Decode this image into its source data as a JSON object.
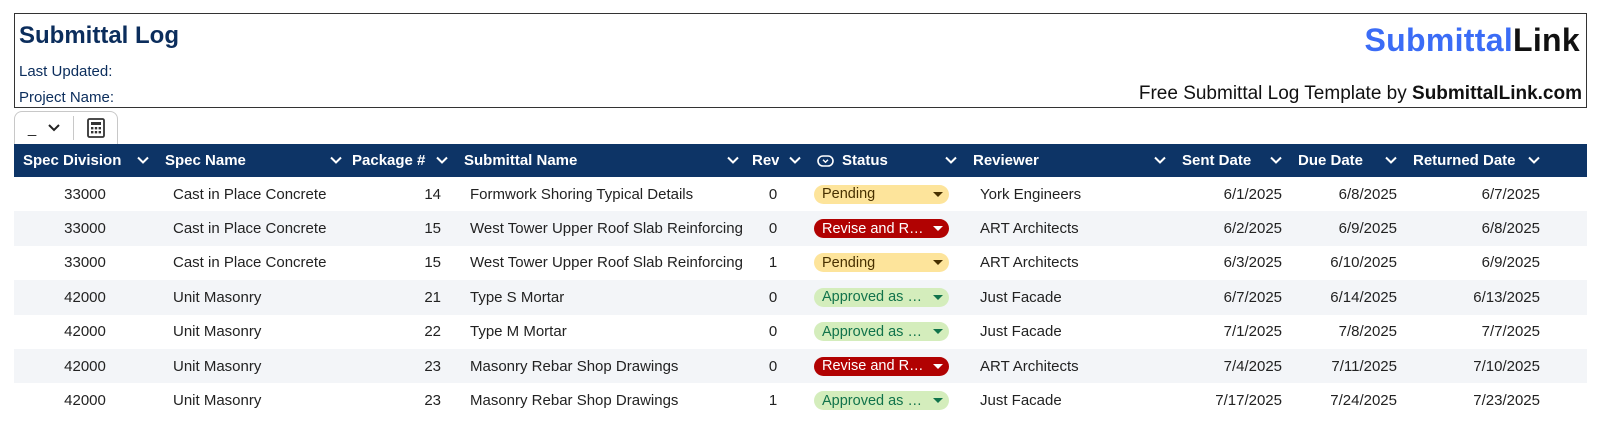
{
  "header": {
    "title": "Submittal Log",
    "last_updated_label": "Last Updated:",
    "project_name_label": "Project Name:",
    "brand_part1": "Submittal",
    "brand_part2": "Link",
    "tagline_prefix": "Free Submittal Log Template by ",
    "tagline_site": "SubmittalLink.com"
  },
  "toolbar": {
    "view_select_value": "_"
  },
  "columns": [
    {
      "label": "Spec Division"
    },
    {
      "label": "Spec Name"
    },
    {
      "label": "Package #"
    },
    {
      "label": "Submittal Name"
    },
    {
      "label": "Rev"
    },
    {
      "label": "Status"
    },
    {
      "label": "Reviewer"
    },
    {
      "label": "Sent Date"
    },
    {
      "label": "Due Date"
    },
    {
      "label": "Returned Date"
    }
  ],
  "rows": [
    {
      "division": "33000",
      "spec_name": "Cast in Place Concrete",
      "package": "14",
      "submittal": "Formwork Shoring Typical Details",
      "rev": "0",
      "status": "Pending",
      "status_type": "pending",
      "reviewer": "York Engineers",
      "sent": "6/1/2025",
      "due": "6/8/2025",
      "returned": "6/7/2025"
    },
    {
      "division": "33000",
      "spec_name": "Cast in Place Concrete",
      "package": "15",
      "submittal": "West Tower Upper Roof Slab Reinforcing",
      "rev": "0",
      "status": "Revise and R…",
      "status_type": "revise",
      "reviewer": "ART Architects",
      "sent": "6/2/2025",
      "due": "6/9/2025",
      "returned": "6/8/2025"
    },
    {
      "division": "33000",
      "spec_name": "Cast in Place Concrete",
      "package": "15",
      "submittal": "West Tower Upper Roof Slab Reinforcing",
      "rev": "1",
      "status": "Pending",
      "status_type": "pending",
      "reviewer": "ART Architects",
      "sent": "6/3/2025",
      "due": "6/10/2025",
      "returned": "6/9/2025"
    },
    {
      "division": "42000",
      "spec_name": "Unit Masonry",
      "package": "21",
      "submittal": "Type S Mortar",
      "rev": "0",
      "status": "Approved as …",
      "status_type": "approved",
      "reviewer": "Just Facade",
      "sent": "6/7/2025",
      "due": "6/14/2025",
      "returned": "6/13/2025"
    },
    {
      "division": "42000",
      "spec_name": "Unit Masonry",
      "package": "22",
      "submittal": "Type M Mortar",
      "rev": "0",
      "status": "Approved as …",
      "status_type": "approved",
      "reviewer": "Just Facade",
      "sent": "7/1/2025",
      "due": "7/8/2025",
      "returned": "7/7/2025"
    },
    {
      "division": "42000",
      "spec_name": "Unit Masonry",
      "package": "23",
      "submittal": "Masonry Rebar Shop Drawings",
      "rev": "0",
      "status": "Revise and R…",
      "status_type": "revise",
      "reviewer": "ART Architects",
      "sent": "7/4/2025",
      "due": "7/11/2025",
      "returned": "7/10/2025"
    },
    {
      "division": "42000",
      "spec_name": "Unit Masonry",
      "package": "23",
      "submittal": "Masonry Rebar Shop Drawings",
      "rev": "1",
      "status": "Approved as …",
      "status_type": "approved",
      "reviewer": "Just Facade",
      "sent": "7/17/2025",
      "due": "7/24/2025",
      "returned": "7/23/2025"
    }
  ],
  "colors": {
    "header_bg": "#0d3466",
    "title": "#0b2d5c",
    "brand_blue": "#3b6cf6",
    "pending_chip": "#fde49b",
    "revise_chip": "#b10202",
    "approved_chip": "#d4edbc"
  },
  "icons": {
    "column_menu": "chevron-down-icon",
    "status_column": "dropdown-chip-icon",
    "toolbar_calc": "calculator-icon"
  }
}
